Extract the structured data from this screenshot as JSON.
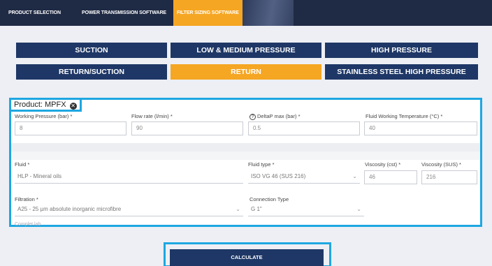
{
  "topnav": {
    "tabs": [
      {
        "label": "PRODUCT SELECTION"
      },
      {
        "label": "POWER TRANSMISSION SOFTWARE"
      },
      {
        "label": "FILTER SIZING SOFTWARE"
      }
    ],
    "active_tab": "FILTER SIZING SOFTWARE"
  },
  "categories": [
    {
      "label": "SUCTION"
    },
    {
      "label": "LOW & MEDIUM PRESSURE"
    },
    {
      "label": "HIGH PRESSURE"
    },
    {
      "label": "RETURN/SUCTION"
    },
    {
      "label": "RETURN"
    },
    {
      "label": "STAINLESS STEEL HIGH PRESSURE"
    }
  ],
  "active_category": "RETURN",
  "product": {
    "label": "Product: MPFX",
    "remove_icon": "close-circle-icon"
  },
  "fields": {
    "working_pressure": {
      "label": "Working Pressure (bar) *",
      "value": "8"
    },
    "flow_rate": {
      "label": "Flow rate (l/min) *",
      "value": "90"
    },
    "delta_p": {
      "label": "DeltaP max (bar) *",
      "value": "0.5",
      "icon": "question-icon"
    },
    "fluid_temp": {
      "label": "Fluid Working Temperature (°C) *",
      "value": "40"
    },
    "fluid": {
      "label": "Fluid *",
      "value": "HLP - Mineral oils"
    },
    "fluid_type": {
      "label": "Fluid type *",
      "value": "ISO VG 46 (SUS 216)"
    },
    "viscosity_cst": {
      "label": "Viscosity (cst) *",
      "value": "46"
    },
    "viscosity_sus": {
      "label": "Viscosity (SUS) *",
      "value": "216"
    },
    "filtration": {
      "label": "Filtration *",
      "value": "A25 - 25 µm absolute inorganic microfibre"
    },
    "connection_type": {
      "label": "Connection Type",
      "value": "G 1\""
    }
  },
  "footer_label": "Complet lab",
  "calculate_label": "CALCULATE",
  "colors": {
    "navy": "#1e3766",
    "accent_orange": "#f5a623",
    "highlight_blue": "#1ea7e1"
  }
}
